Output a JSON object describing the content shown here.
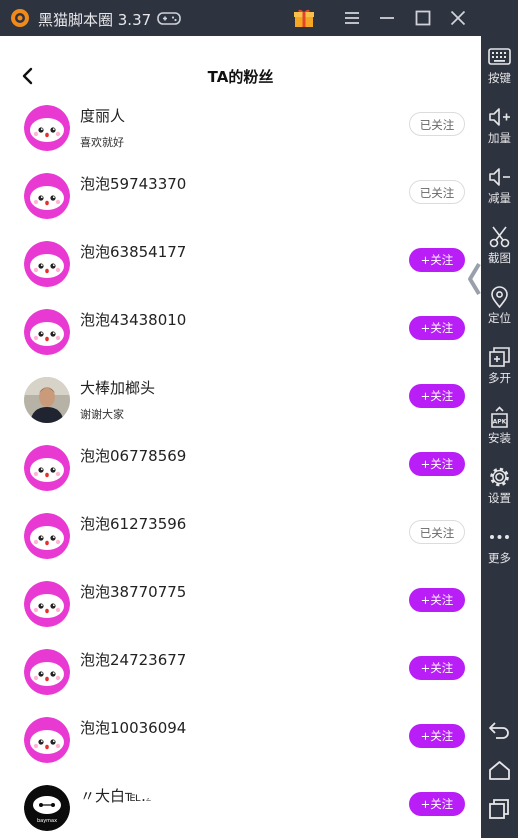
{
  "window": {
    "title": "黑猫脚本圈 3.37",
    "icons": [
      "app-logo-icon",
      "gamepad-icon",
      "gift-icon",
      "menu-icon",
      "minimize-icon",
      "maximize-icon",
      "close-icon",
      "collapse-icon"
    ]
  },
  "page": {
    "title": "TA的粉丝",
    "back_icon": "back-arrow-icon"
  },
  "fans": [
    {
      "name": "度丽人",
      "subtitle": "喜欢就好",
      "button": "已关注",
      "followed": true,
      "avatar": "pink-cartoon"
    },
    {
      "name": "泡泡59743370",
      "subtitle": "",
      "button": "已关注",
      "followed": true,
      "avatar": "pink-cartoon"
    },
    {
      "name": "泡泡63854177",
      "subtitle": "",
      "button": "+关注",
      "followed": false,
      "avatar": "pink-cartoon"
    },
    {
      "name": "泡泡43438010",
      "subtitle": "",
      "button": "+关注",
      "followed": false,
      "avatar": "pink-cartoon"
    },
    {
      "name": "大棒加榔头",
      "subtitle": "谢谢大家",
      "button": "+关注",
      "followed": false,
      "avatar": "photo"
    },
    {
      "name": "泡泡06778569",
      "subtitle": "",
      "button": "+关注",
      "followed": false,
      "avatar": "pink-cartoon"
    },
    {
      "name": "泡泡61273596",
      "subtitle": "",
      "button": "已关注",
      "followed": true,
      "avatar": "pink-cartoon"
    },
    {
      "name": "泡泡38770775",
      "subtitle": "",
      "button": "+关注",
      "followed": false,
      "avatar": "pink-cartoon"
    },
    {
      "name": "泡泡24723677",
      "subtitle": "",
      "button": "+关注",
      "followed": false,
      "avatar": "pink-cartoon"
    },
    {
      "name": "泡泡10036094",
      "subtitle": "",
      "button": "+关注",
      "followed": false,
      "avatar": "pink-cartoon"
    },
    {
      "name": "〃大白℡.ۦ",
      "subtitle": "",
      "button": "+关注",
      "followed": false,
      "avatar": "baymax"
    }
  ],
  "sidebar": {
    "items": [
      {
        "label": "按键",
        "icon": "keyboard-icon"
      },
      {
        "label": "加量",
        "icon": "volume-up-icon"
      },
      {
        "label": "减量",
        "icon": "volume-down-icon"
      },
      {
        "label": "截图",
        "icon": "scissors-icon"
      },
      {
        "label": "定位",
        "icon": "location-pin-icon"
      },
      {
        "label": "多开",
        "icon": "multi-window-icon"
      },
      {
        "label": "安装",
        "icon": "apk-install-icon"
      },
      {
        "label": "设置",
        "icon": "gear-icon"
      },
      {
        "label": "更多",
        "icon": "more-dots-icon"
      }
    ],
    "nav": [
      "back-icon",
      "home-icon",
      "recent-apps-icon"
    ]
  },
  "colors": {
    "accent": "#b81ef5",
    "avatar_pink": "#e83ad2",
    "chrome": "#2e3340",
    "followed_border": "#dcdcdc"
  },
  "avatar_badge": "baymax"
}
